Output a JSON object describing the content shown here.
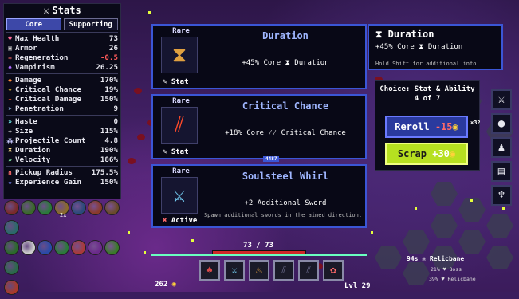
{
  "stats_panel": {
    "title": "Stats",
    "tabs": [
      {
        "label": "Core"
      },
      {
        "label": "Supporting"
      }
    ],
    "groups": [
      [
        {
          "icon": "heart-icon",
          "glyph": "♥",
          "color": "#ff6b9a",
          "label": "Max Health",
          "value": "73"
        },
        {
          "icon": "shield-icon",
          "glyph": "▣",
          "color": "#c9c9c9",
          "label": "Armor",
          "value": "26"
        },
        {
          "icon": "plus-icon",
          "glyph": "✚",
          "color": "#ff6b6b",
          "label": "Regeneration",
          "value": "-0.5",
          "negative": true
        },
        {
          "icon": "fang-icon",
          "glyph": "♠",
          "color": "#b06cff",
          "label": "Vampirism",
          "value": "26.25"
        }
      ],
      [
        {
          "icon": "damage-icon",
          "glyph": "◆",
          "color": "#ff8a3a",
          "label": "Damage",
          "value": "170%"
        },
        {
          "icon": "crit-chance-icon",
          "glyph": "✦",
          "color": "#ffd23a",
          "label": "Critical Chance",
          "value": "19%"
        },
        {
          "icon": "crit-damage-icon",
          "glyph": "✦",
          "color": "#ff5a3a",
          "label": "Critical Damage",
          "value": "150%"
        },
        {
          "icon": "penetration-icon",
          "glyph": "➤",
          "color": "#a0c8ff",
          "label": "Penetration",
          "value": "9"
        }
      ],
      [
        {
          "icon": "haste-icon",
          "glyph": "»",
          "color": "#7affff",
          "label": "Haste",
          "value": "0"
        },
        {
          "icon": "size-icon",
          "glyph": "✚",
          "color": "#ffffff",
          "label": "Size",
          "value": "115%"
        },
        {
          "icon": "projectile-icon",
          "glyph": "⁂",
          "color": "#c8c8ff",
          "label": "Projectile Count",
          "value": "4.8"
        },
        {
          "icon": "hourglass-icon",
          "glyph": "⧗",
          "color": "#ffe08a",
          "label": "Duration",
          "value": "190%"
        },
        {
          "icon": "velocity-icon",
          "glyph": "»",
          "color": "#8affb0",
          "label": "Velocity",
          "value": "186%"
        }
      ],
      [
        {
          "icon": "magnet-icon",
          "glyph": "∩",
          "color": "#ff6b6b",
          "label": "Pickup Radius",
          "value": "175.5%"
        },
        {
          "icon": "xp-icon",
          "glyph": "★",
          "color": "#7a8aff",
          "label": "Experience Gain",
          "value": "150%"
        }
      ]
    ]
  },
  "relics": {
    "row1": [
      {
        "icon": "relic-icon",
        "color": "#7a2a2a"
      },
      {
        "icon": "relic-icon",
        "color": "#3a6a2a"
      },
      {
        "icon": "relic-icon",
        "color": "#2a7a3a"
      },
      {
        "icon": "relic-icon",
        "color": "#8a6a2a"
      },
      {
        "icon": "relic-icon",
        "color": "#2a4a7a"
      },
      {
        "icon": "relic-icon",
        "color": "#8a3a2a"
      },
      {
        "icon": "relic-icon",
        "color": "#6a4a2a"
      },
      {
        "icon": "relic-icon",
        "color": "#2a6a6a"
      }
    ],
    "row1_badge": "2x",
    "row2": [
      {
        "icon": "relic-icon",
        "color": "#2a6a2a"
      },
      {
        "icon": "skull-icon",
        "color": "#cccccc"
      },
      {
        "icon": "relic-icon",
        "color": "#2a4aa8"
      },
      {
        "icon": "relic-icon",
        "color": "#2a7a3a"
      },
      {
        "icon": "relic-icon",
        "color": "#a83a3a"
      },
      {
        "icon": "relic-icon",
        "color": "#6a2a8a"
      },
      {
        "icon": "relic-icon",
        "color": "#3a7a2a"
      },
      {
        "icon": "relic-icon",
        "color": "#2a6a4a"
      }
    ],
    "row3": [
      {
        "icon": "flame-icon",
        "color": "#a83a2a"
      }
    ]
  },
  "cards": [
    {
      "rarity": "Rare",
      "name": "Duration",
      "desc": "+45% Core ⧗ Duration",
      "sub": "",
      "kind": "Stat",
      "glyph": "⧗",
      "art_color": "#e0a040"
    },
    {
      "rarity": "Rare",
      "name": "Critical Chance",
      "desc": "+18% Core ⁄⁄ Critical Chance",
      "sub": "",
      "kind": "Stat",
      "glyph": "⫽",
      "art_color": "#ff4a2a"
    },
    {
      "rarity": "Rare",
      "name": "Soulsteel Whirl",
      "desc": "+2 Additional Sword",
      "sub": "Spawn additional swords in the aimed direction.",
      "kind": "Active",
      "glyph": "⚔",
      "art_color": "#7ad8ff"
    }
  ],
  "info_box": {
    "title": "⧗ Duration",
    "desc": "+45% Core ⧗ Duration",
    "note": "Hold Shift for additional info."
  },
  "choice": {
    "title": "Choice: Stat & Ability",
    "progress": "4 of 7",
    "reroll_label": "Reroll",
    "reroll_cost": "-15",
    "scrap_label": "Scrap",
    "scrap_value": "+30"
  },
  "ability_bar": {
    "icons": [
      {
        "name": "sword-ability-icon",
        "glyph": "⚔"
      },
      {
        "name": "orb-ability-icon",
        "glyph": "●"
      },
      {
        "name": "figure-ability-icon",
        "glyph": "♟"
      },
      {
        "name": "chest-ability-icon",
        "glyph": "▤"
      },
      {
        "name": "crystal-ability-icon",
        "glyph": "♆"
      }
    ],
    "count_label": "×32"
  },
  "hud": {
    "health_text": "73 / 73",
    "health_fraction": 1.0,
    "gold": "262",
    "level": "Lvl 29",
    "boss_text": "94s ☠ Relicbane",
    "boss_sub1": "21% ♥ Boss",
    "boss_sub2": "39% ♥ Relicbane",
    "xp_label": "4487"
  },
  "hotbar": [
    {
      "name": "slot-ability-1",
      "glyph": "♠",
      "color": "#d84a4a"
    },
    {
      "name": "slot-ability-2",
      "glyph": "⚔",
      "color": "#7ad8ff"
    },
    {
      "name": "slot-ability-3",
      "glyph": "♨",
      "color": "#ffb040"
    },
    {
      "name": "slot-ability-4",
      "glyph": "⫽",
      "color": "#6a6a8a"
    },
    {
      "name": "slot-ability-5",
      "glyph": "⫽",
      "color": "#6a6a8a"
    },
    {
      "name": "slot-ability-6",
      "glyph": "✿",
      "color": "#ff6a6a"
    }
  ],
  "colors": {
    "accent": "#3b56d6",
    "scrap": "#b6e020",
    "reroll": "#2a3a9e"
  }
}
